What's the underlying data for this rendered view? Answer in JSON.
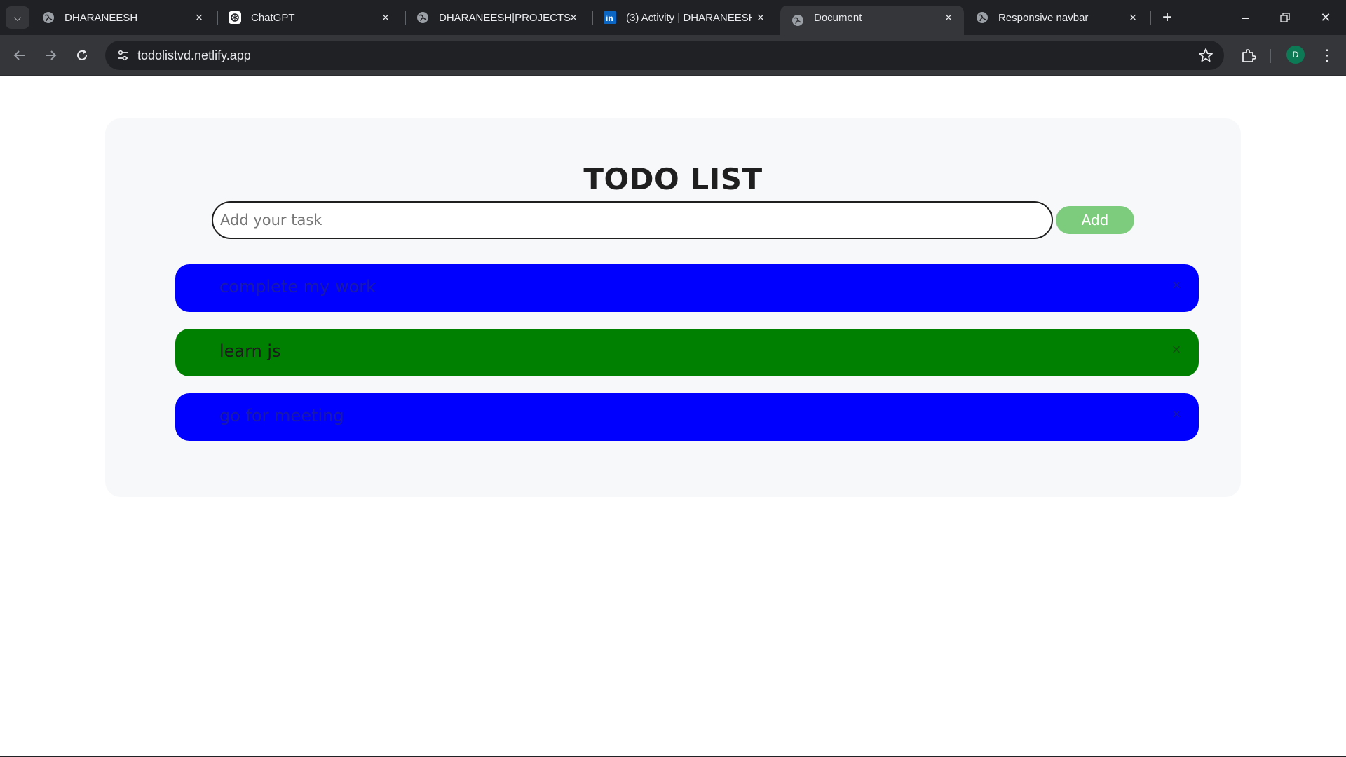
{
  "browser": {
    "tabs": [
      {
        "title": "DHARANEESH",
        "icon": "globe-icon",
        "active": false
      },
      {
        "title": "ChatGPT",
        "icon": "chatgpt-icon",
        "active": false
      },
      {
        "title": "DHARANEESH|PROJECTS",
        "icon": "globe-icon",
        "active": false
      },
      {
        "title": "(3) Activity | DHARANEESH",
        "icon": "linkedin-icon",
        "active": false
      },
      {
        "title": "Document",
        "icon": "globe-icon",
        "active": true
      },
      {
        "title": "Responsive navbar",
        "icon": "globe-icon",
        "active": false
      }
    ],
    "url": "todolistvd.netlify.app",
    "profile_initial": "D"
  },
  "app": {
    "title": "TODO LIST",
    "input": {
      "placeholder": "Add your task",
      "value": ""
    },
    "add_label": "Add",
    "tasks": [
      {
        "text": "complete my work",
        "color": "#0000ff"
      },
      {
        "text": "learn js",
        "color": "#008000"
      },
      {
        "text": "go for meeting",
        "color": "#0000ff"
      }
    ],
    "delete_glyph": "×"
  },
  "colors": {
    "add_button": "#7dcc7d",
    "card_background": "#f7f8fa",
    "chrome_dark": "#202124"
  }
}
